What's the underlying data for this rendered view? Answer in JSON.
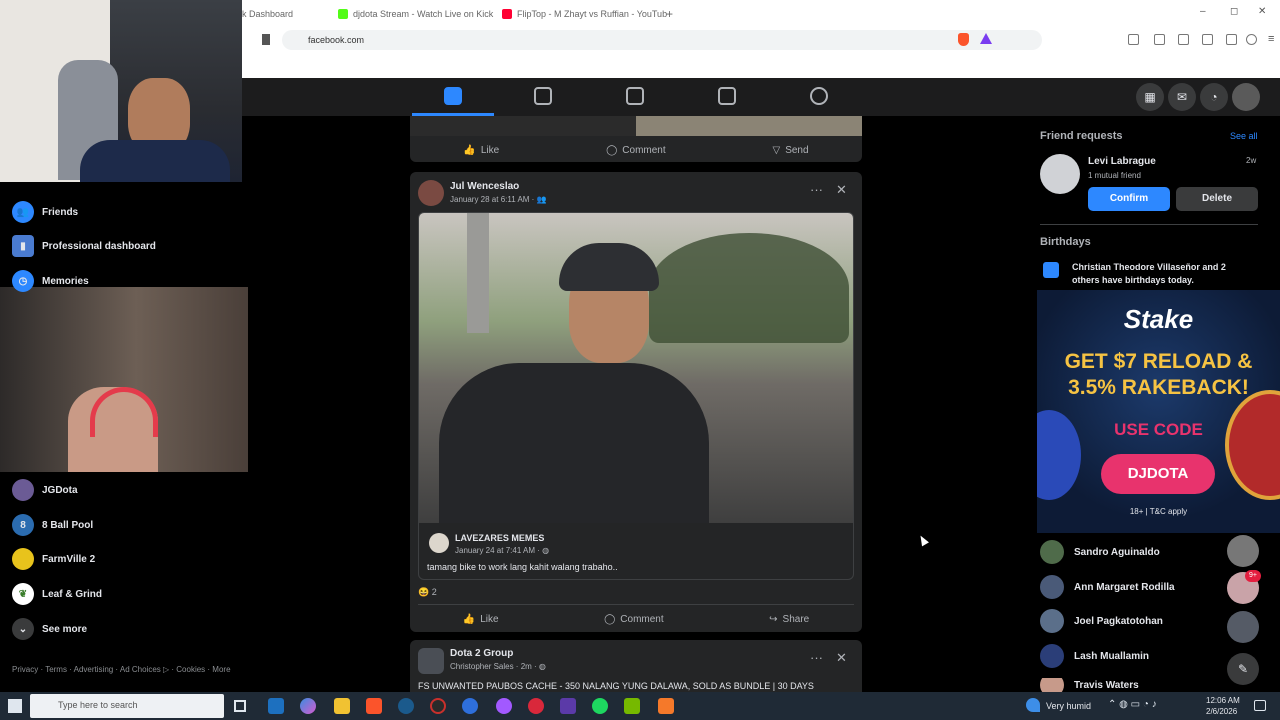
{
  "browser": {
    "tabs": [
      "k Dashboard",
      "djdota Stream - Watch Live on Kick",
      "FlipTop - M Zhayt vs Ruffian - YouTub"
    ],
    "url": "facebook.com"
  },
  "sidebar": {
    "items": [
      {
        "label": "Friends",
        "icon": "friends-icon",
        "color": "#2d88ff"
      },
      {
        "label": "Professional dashboard",
        "icon": "dashboard-icon",
        "color": "#4a7bd0"
      },
      {
        "label": "Memories",
        "icon": "memories-icon",
        "color": "#2d88ff"
      }
    ],
    "shortcuts": [
      {
        "label": "JGDota",
        "icon": "jgdota-icon",
        "color": "#6b5b95"
      },
      {
        "label": "8 Ball Pool",
        "icon": "8ball-icon",
        "color": "#2b6cb0"
      },
      {
        "label": "FarmVille 2",
        "icon": "farmville-icon",
        "color": "#e8c31c"
      },
      {
        "label": "Leaf & Grind",
        "icon": "leaf-icon",
        "color": "#ffffff"
      }
    ],
    "see_more": "See more",
    "footer": "Privacy · Terms · Advertising · Ad Choices ▷ · Cookies · More"
  },
  "feed": {
    "prev_actions": {
      "like": "Like",
      "comment": "Comment",
      "send": "Send"
    },
    "post1": {
      "author": "Jul Wenceslao",
      "time": "January 28 at 6:11 AM · ",
      "shared_author": "LAVEZARES MEMES",
      "shared_time": "January 24 at 7:41 AM · ",
      "shared_text": "tamang bike to work lang kahit walang trabaho..",
      "reactions": "2",
      "actions": {
        "like": "Like",
        "comment": "Comment",
        "share": "Share"
      }
    },
    "post2": {
      "author": "Dota 2 Group",
      "meta": "Christopher Sales · 2m · ",
      "text": "FS UNWANTED PAUBOS CACHE - 350 NALANG YUNG DALAWA, SOLD AS BUNDLE | 30 DAYS"
    }
  },
  "right": {
    "friend_requests_title": "Friend requests",
    "see_all": "See all",
    "request": {
      "name": "Levi Labrague",
      "mutual": "1 mutual friend",
      "age": "2w",
      "confirm": "Confirm",
      "delete": "Delete"
    },
    "birthdays_title": "Birthdays",
    "birthday_text": "Christian Theodore Villaseñor and 2 others have birthdays today.",
    "contacts": [
      "Sandro Aguinaldo",
      "Ann Margaret Rodilla",
      "Joel Pagkatotohan",
      "Lash Muallamin",
      "Travis Waters"
    ]
  },
  "ad": {
    "brand": "Stake",
    "line1": "GET $7 RELOAD &",
    "line2": "3.5% RAKEBACK!",
    "use_code": "USE CODE",
    "code": "DJDOTA",
    "fine": "18+ | T&C apply"
  },
  "taskbar": {
    "search": "Type here to search",
    "weather": "Very humid",
    "time": "12:06 AM",
    "date": "2/6/2026"
  },
  "colors": {
    "fb_blue": "#2d88ff",
    "stake_gold": "#f6c343",
    "stake_pink": "#e8336d",
    "card": "#242526"
  }
}
